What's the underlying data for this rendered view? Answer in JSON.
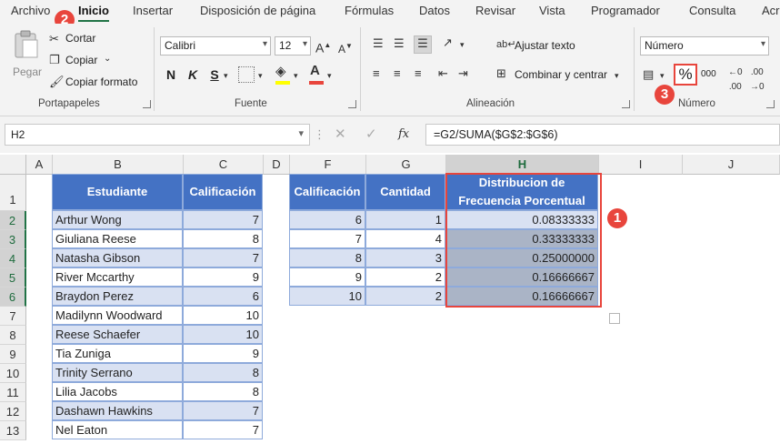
{
  "tabs": [
    "Archivo",
    "Inicio",
    "Insertar",
    "Disposición de página",
    "Fórmulas",
    "Datos",
    "Revisar",
    "Vista",
    "Programador",
    "Consulta",
    "Acr"
  ],
  "clipboard": {
    "paste": "Pegar",
    "cut": "Cortar",
    "copy": "Copiar",
    "format_painter": "Copiar formato",
    "label": "Portapapeles"
  },
  "font": {
    "name": "Calibri",
    "size": "12",
    "label": "Fuente",
    "bold": "N",
    "italic": "K",
    "underline": "S"
  },
  "alignment": {
    "wrap": "Ajustar texto",
    "merge": "Combinar y centrar",
    "label": "Alineación"
  },
  "number": {
    "format": "Número",
    "percent": "%",
    "comma": "000",
    "label": "Número"
  },
  "badges": {
    "one": "1",
    "two": "2",
    "three": "3"
  },
  "colors": {
    "accent_green": "#217346",
    "table_header": "#4472c4",
    "band": "#d9e1f2",
    "highlight": "#e8453c",
    "font_color": "#e8453c",
    "fill_color": "#ffff00"
  },
  "formula_bar": {
    "cell": "H2",
    "formula": "=G2/SUMA($G$2:$G$6)"
  },
  "columns": [
    "A",
    "B",
    "C",
    "D",
    "F",
    "G",
    "H",
    "I",
    "J"
  ],
  "rows": [
    "1",
    "2",
    "3",
    "4",
    "5",
    "6",
    "7",
    "8",
    "9",
    "10",
    "11",
    "12",
    "13"
  ],
  "students": {
    "headers": [
      "Estudiante",
      "Calificación"
    ],
    "rows": [
      [
        "Arthur Wong",
        "7"
      ],
      [
        "Giuliana Reese",
        "8"
      ],
      [
        "Natasha Gibson",
        "7"
      ],
      [
        "River Mccarthy",
        "9"
      ],
      [
        "Braydon Perez",
        "6"
      ],
      [
        "Madilynn Woodward",
        "10"
      ],
      [
        "Reese Schaefer",
        "10"
      ],
      [
        "Tia Zuniga",
        "9"
      ],
      [
        "Trinity Serrano",
        "8"
      ],
      [
        "Lilia Jacobs",
        "8"
      ],
      [
        "Dashawn Hawkins",
        "7"
      ],
      [
        "Nel Eaton",
        "7"
      ]
    ]
  },
  "frequency": {
    "headers": [
      "Calificación",
      "Cantidad",
      "Distribucion de Frecuencia Porcentual"
    ],
    "rows": [
      [
        "6",
        "1",
        "0.08333333"
      ],
      [
        "7",
        "4",
        "0.33333333"
      ],
      [
        "8",
        "3",
        "0.25000000"
      ],
      [
        "9",
        "2",
        "0.16666667"
      ],
      [
        "10",
        "2",
        "0.16666667"
      ]
    ]
  }
}
